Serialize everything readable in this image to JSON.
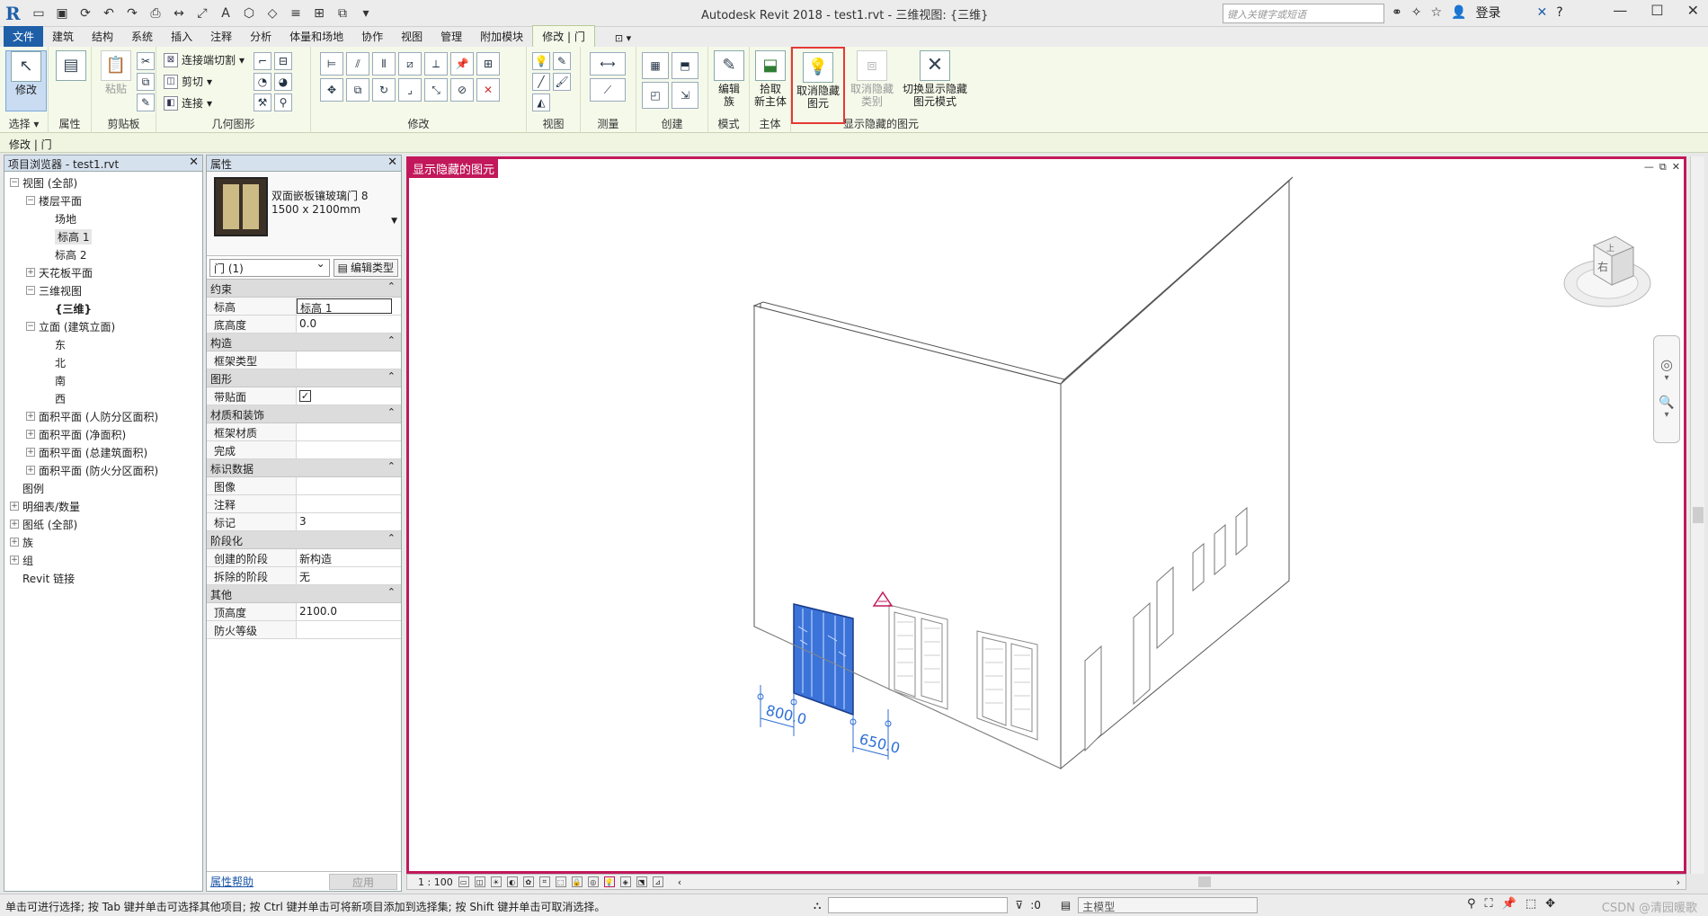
{
  "titlebar": {
    "app_title": "Autodesk Revit 2018  -  test1.rvt - 三维视图: {三维}",
    "search_placeholder": "键入关键字或短语",
    "login": "登录"
  },
  "menu": {
    "tabs": [
      "文件",
      "建筑",
      "结构",
      "系统",
      "插入",
      "注释",
      "分析",
      "体量和场地",
      "协作",
      "视图",
      "管理",
      "附加模块",
      "修改 | 门"
    ],
    "active_tab": "修改 | 门"
  },
  "ribbon": {
    "select": {
      "button": "修改",
      "label": "选择 ▾"
    },
    "properties": {
      "label": "属性"
    },
    "clipboard": {
      "paste": "粘贴",
      "label": "剪贴板"
    },
    "geometry": {
      "join_cut": "连接端切割",
      "cut": "剪切",
      "join": "连接",
      "label": "几何图形"
    },
    "modify": {
      "label": "修改"
    },
    "view": {
      "label": "视图"
    },
    "measure": {
      "label": "测量"
    },
    "create": {
      "label": "创建"
    },
    "mode": {
      "edit_family": "编辑\n族",
      "label": "模式"
    },
    "host": {
      "pick_host": "拾取\n新主体",
      "label": "主体"
    },
    "reveal": {
      "unhide_element": "取消隐藏\n图元",
      "unhide_category": "取消隐藏\n类别",
      "toggle_mode": "切换显示隐藏\n图元模式",
      "label": "显示隐藏的图元"
    }
  },
  "context_bar": "修改 | 门",
  "browser": {
    "title": "项目浏览器 - test1.rvt",
    "nodes": [
      {
        "label": "视图 (全部)",
        "level": 0,
        "toggle": "−"
      },
      {
        "label": "楼层平面",
        "level": 1,
        "toggle": "−"
      },
      {
        "label": "场地",
        "level": 2,
        "toggle": ""
      },
      {
        "label": "标高 1",
        "level": 2,
        "toggle": "",
        "selected": true
      },
      {
        "label": "标高 2",
        "level": 2,
        "toggle": ""
      },
      {
        "label": "天花板平面",
        "level": 1,
        "toggle": "+"
      },
      {
        "label": "三维视图",
        "level": 1,
        "toggle": "−"
      },
      {
        "label": "{三维}",
        "level": 2,
        "toggle": "",
        "bold": true
      },
      {
        "label": "立面 (建筑立面)",
        "level": 1,
        "toggle": "−"
      },
      {
        "label": "东",
        "level": 2,
        "toggle": ""
      },
      {
        "label": "北",
        "level": 2,
        "toggle": ""
      },
      {
        "label": "南",
        "level": 2,
        "toggle": ""
      },
      {
        "label": "西",
        "level": 2,
        "toggle": ""
      },
      {
        "label": "面积平面 (人防分区面积)",
        "level": 1,
        "toggle": "+"
      },
      {
        "label": "面积平面 (净面积)",
        "level": 1,
        "toggle": "+"
      },
      {
        "label": "面积平面 (总建筑面积)",
        "level": 1,
        "toggle": "+"
      },
      {
        "label": "面积平面 (防火分区面积)",
        "level": 1,
        "toggle": "+"
      },
      {
        "label": "图例",
        "level": 0,
        "toggle": ""
      },
      {
        "label": "明细表/数量",
        "level": 0,
        "toggle": "+"
      },
      {
        "label": "图纸 (全部)",
        "level": 0,
        "toggle": "+"
      },
      {
        "label": "族",
        "level": 0,
        "toggle": "+"
      },
      {
        "label": "组",
        "level": 0,
        "toggle": "+"
      },
      {
        "label": "Revit 链接",
        "level": 0,
        "toggle": ""
      }
    ]
  },
  "properties": {
    "title": "属性",
    "type_name_line1": "双面嵌板镶玻璃门 8",
    "type_name_line2": "1500 x 2100mm",
    "instance_filter": "门 (1)",
    "edit_type": "编辑类型",
    "groups": [
      {
        "name": "约束",
        "rows": [
          {
            "k": "标高",
            "v": "标高 1",
            "edit": true
          },
          {
            "k": "底高度",
            "v": "0.0"
          }
        ]
      },
      {
        "name": "构造",
        "rows": [
          {
            "k": "框架类型",
            "v": ""
          }
        ]
      },
      {
        "name": "图形",
        "rows": [
          {
            "k": "带贴面",
            "v": "✓",
            "check": true
          }
        ]
      },
      {
        "name": "材质和装饰",
        "rows": [
          {
            "k": "框架材质",
            "v": ""
          },
          {
            "k": "完成",
            "v": ""
          }
        ]
      },
      {
        "name": "标识数据",
        "rows": [
          {
            "k": "图像",
            "v": ""
          },
          {
            "k": "注释",
            "v": ""
          },
          {
            "k": "标记",
            "v": "3"
          }
        ]
      },
      {
        "name": "阶段化",
        "rows": [
          {
            "k": "创建的阶段",
            "v": "新构造"
          },
          {
            "k": "拆除的阶段",
            "v": "无"
          }
        ]
      },
      {
        "name": "其他",
        "rows": [
          {
            "k": "顶高度",
            "v": "2100.0"
          },
          {
            "k": "防火等级",
            "v": ""
          }
        ]
      }
    ],
    "help_link": "属性帮助",
    "apply": "应用"
  },
  "viewport": {
    "mode_tag": "显示隐藏的图元",
    "dim1": "800.0",
    "dim2": "650.0",
    "cube_face": "右",
    "cube_top": "上"
  },
  "viewbar": {
    "scale": "1 : 100"
  },
  "status": {
    "hint": "单击可进行选择; 按 Tab 键并单击可选择其他项目; 按 Ctrl 键并单击可将新项目添加到选择集; 按 Shift 键并单击可取消选择。",
    "count": ":0",
    "model": "主模型",
    "watermark": "CSDN @清园暖歌"
  },
  "colors": {
    "accent": "#c2185b",
    "selection_blue": "#2f6fd6",
    "file_tab": "#1f5fa8"
  }
}
